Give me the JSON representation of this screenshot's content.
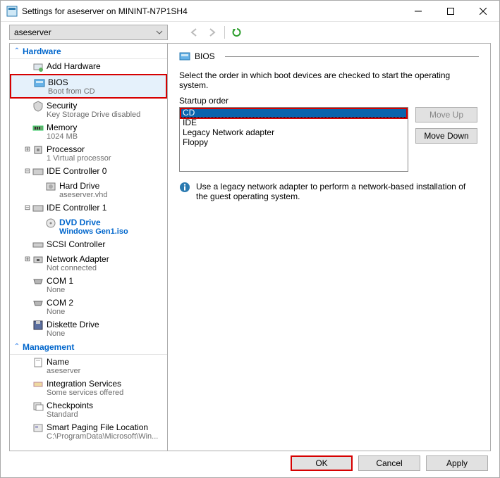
{
  "window": {
    "title": "Settings for aseserver on MININT-N7P1SH4",
    "vm_selected": "aseserver"
  },
  "sections": {
    "hardware": "Hardware",
    "management": "Management"
  },
  "tree": {
    "add_hardware": "Add Hardware",
    "bios": {
      "label": "BIOS",
      "sub": "Boot from CD"
    },
    "security": {
      "label": "Security",
      "sub": "Key Storage Drive disabled"
    },
    "memory": {
      "label": "Memory",
      "sub": "1024 MB"
    },
    "processor": {
      "label": "Processor",
      "sub": "1 Virtual processor"
    },
    "ide0": {
      "label": "IDE Controller 0"
    },
    "hard_drive": {
      "label": "Hard Drive",
      "sub": "aseserver.vhd"
    },
    "ide1": {
      "label": "IDE Controller 1"
    },
    "dvd": {
      "label": "DVD Drive",
      "sub": "Windows Gen1.iso"
    },
    "scsi": {
      "label": "SCSI Controller"
    },
    "netadapter": {
      "label": "Network Adapter",
      "sub": "Not connected"
    },
    "com1": {
      "label": "COM 1",
      "sub": "None"
    },
    "com2": {
      "label": "COM 2",
      "sub": "None"
    },
    "diskette": {
      "label": "Diskette Drive",
      "sub": "None"
    },
    "name": {
      "label": "Name",
      "sub": "aseserver"
    },
    "integration": {
      "label": "Integration Services",
      "sub": "Some services offered"
    },
    "checkpoints": {
      "label": "Checkpoints",
      "sub": "Standard"
    },
    "paging": {
      "label": "Smart Paging File Location",
      "sub": "C:\\ProgramData\\Microsoft\\Win..."
    }
  },
  "panel": {
    "title": "BIOS",
    "description": "Select the order in which boot devices are checked to start the operating system.",
    "startup_label": "Startup order",
    "options": [
      "CD",
      "IDE",
      "Legacy Network adapter",
      "Floppy"
    ],
    "selected_index": 0,
    "move_up": "Move Up",
    "move_down": "Move Down",
    "info": "Use a legacy network adapter to perform a network-based installation of the guest operating system."
  },
  "footer": {
    "ok": "OK",
    "cancel": "Cancel",
    "apply": "Apply"
  }
}
